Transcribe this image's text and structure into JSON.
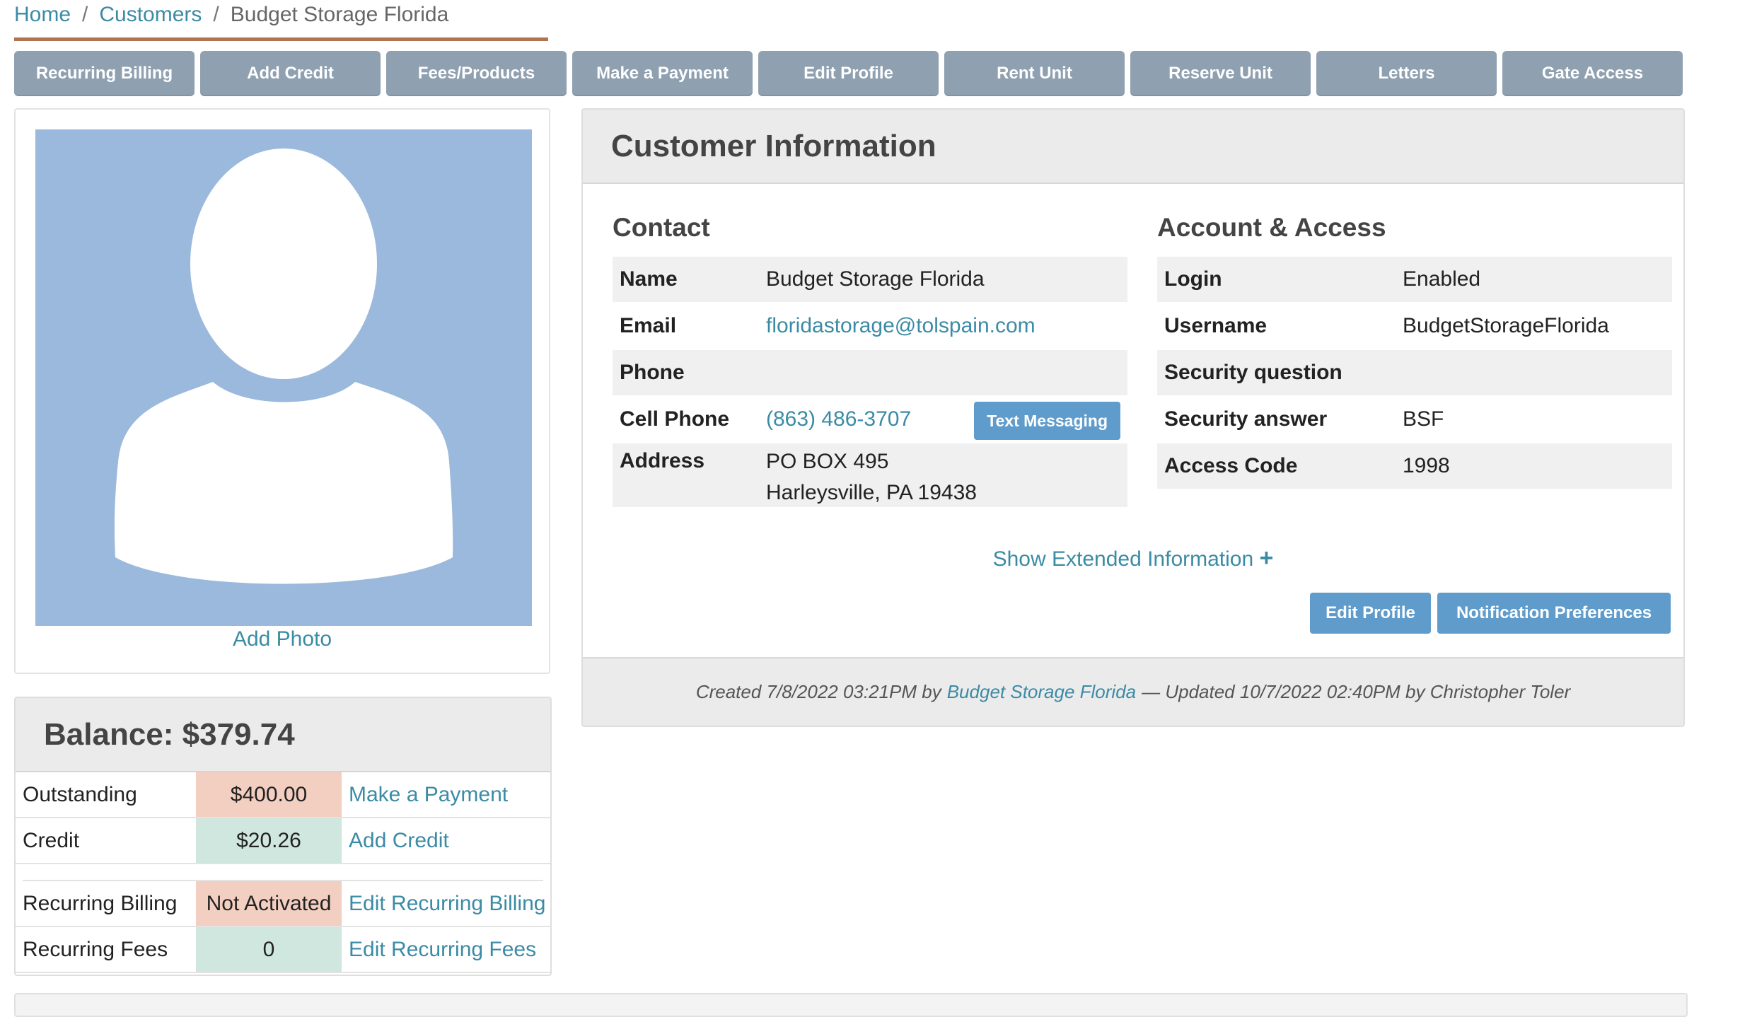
{
  "breadcrumb": {
    "home": "Home",
    "customers": "Customers",
    "current": "Budget Storage Florida",
    "separator": "/"
  },
  "actions": [
    "Recurring Billing",
    "Add Credit",
    "Fees/Products",
    "Make a Payment",
    "Edit Profile",
    "Rent Unit",
    "Reserve Unit",
    "Letters",
    "Gate Access"
  ],
  "photo": {
    "add_label": "Add Photo",
    "placeholder_icon": "user-silhouette-icon"
  },
  "balance": {
    "title": "Balance: $379.74",
    "rows": [
      {
        "label": "Outstanding",
        "value": "$400.00",
        "action": "Make a Payment"
      },
      {
        "label": "Credit",
        "value": "$20.26",
        "action": "Add Credit"
      }
    ],
    "rows2": [
      {
        "label": "Recurring Billing",
        "value": "Not Activated",
        "action": "Edit Recurring Billing"
      },
      {
        "label": "Recurring Fees",
        "value": "0",
        "action": "Edit Recurring Fees"
      }
    ]
  },
  "customer_info": {
    "title": "Customer Information",
    "contact": {
      "title": "Contact",
      "name_label": "Name",
      "name": "Budget Storage Florida",
      "email_label": "Email",
      "email": "floridastorage@tolspain.com",
      "phone_label": "Phone",
      "phone": "",
      "cell_label": "Cell Phone",
      "cell": "(863) 486-3707",
      "text_btn": "Text Messaging",
      "address_label": "Address",
      "address_line1": "PO BOX 495",
      "address_line2": "Harleysville, PA 19438"
    },
    "account": {
      "title": "Account & Access",
      "login_label": "Login",
      "login": "Enabled",
      "username_label": "Username",
      "username": "BudgetStorageFlorida",
      "secq_label": "Security question",
      "secq": "",
      "seca_label": "Security answer",
      "seca": "BSF",
      "code_label": "Access Code",
      "code": "1998"
    },
    "show_extended": "Show Extended Information",
    "edit_profile": "Edit Profile",
    "notification_prefs": "Notification Preferences",
    "footer": {
      "created": "Created 7/8/2022 03:21PM by",
      "created_by": "Budget Storage Florida",
      "updated": "— Updated 10/7/2022 02:40PM by Christopher Toler"
    }
  },
  "colors": {
    "link": "#3b8ba5",
    "action_btn": "#8fa0b1",
    "primary_btn": "#5f9ccc",
    "photo_bg": "#9bb9dc"
  }
}
